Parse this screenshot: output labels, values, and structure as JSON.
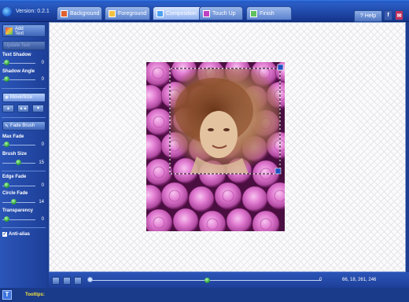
{
  "app": {
    "version": "Version: 0.2.1"
  },
  "tabs": [
    {
      "label": "Background",
      "active": false
    },
    {
      "label": "Foreground",
      "active": false
    },
    {
      "label": "Composition",
      "active": true
    },
    {
      "label": "Touch Up",
      "active": false
    },
    {
      "label": "Finish",
      "active": false
    }
  ],
  "topright": {
    "help_label": "Help",
    "facebook_glyph": "f",
    "mail_glyph": "✉"
  },
  "sidebar": {
    "add_text_line1": "Add",
    "add_text_line2": "Text",
    "disabled_button": "Update Text",
    "text_shadow": {
      "label": "Text Shadow",
      "value": "0",
      "level": 0.0
    },
    "shadow_angle": {
      "label": "Shadow Angle",
      "value": "0",
      "level": 0.0
    },
    "move_size": "Move/Size",
    "mini_buttons": [
      "▲",
      "▲▲",
      "▼"
    ],
    "fade_brush": "Fade Brush",
    "max_fade": {
      "label": "Max Fade",
      "value": "0",
      "level": 0.0
    },
    "brush_size": {
      "label": "Brush Size",
      "value": "15",
      "level": 0.45
    },
    "edge_fade": {
      "label": "Edge Fade",
      "value": "0",
      "level": 0.0
    },
    "circle_fade": {
      "label": "Circle Fade",
      "value": "14",
      "level": 0.3
    },
    "transparency": {
      "label": "Transparency",
      "value": "0",
      "level": 0.0
    },
    "anti_alias": {
      "label": "Anti-alias",
      "checked": true
    }
  },
  "bottom": {
    "zoom_value": "0",
    "pixel_info": "66, 18, 261, 246"
  },
  "status": {
    "t_glyph": "T",
    "tooltips_label": "Tooltips:"
  },
  "colors": {
    "accent": "#1d3f98",
    "rose": "#e07ad0",
    "slider_knob": "#209030"
  },
  "icons": [
    "app-logo-icon",
    "background-tab-icon",
    "foreground-tab-icon",
    "composition-tab-icon",
    "touchup-tab-icon",
    "finish-tab-icon",
    "help-icon",
    "facebook-icon",
    "mail-icon",
    "add-text-icon",
    "move-size-icon",
    "fade-brush-icon",
    "checkbox-icon",
    "text-tool-icon"
  ]
}
